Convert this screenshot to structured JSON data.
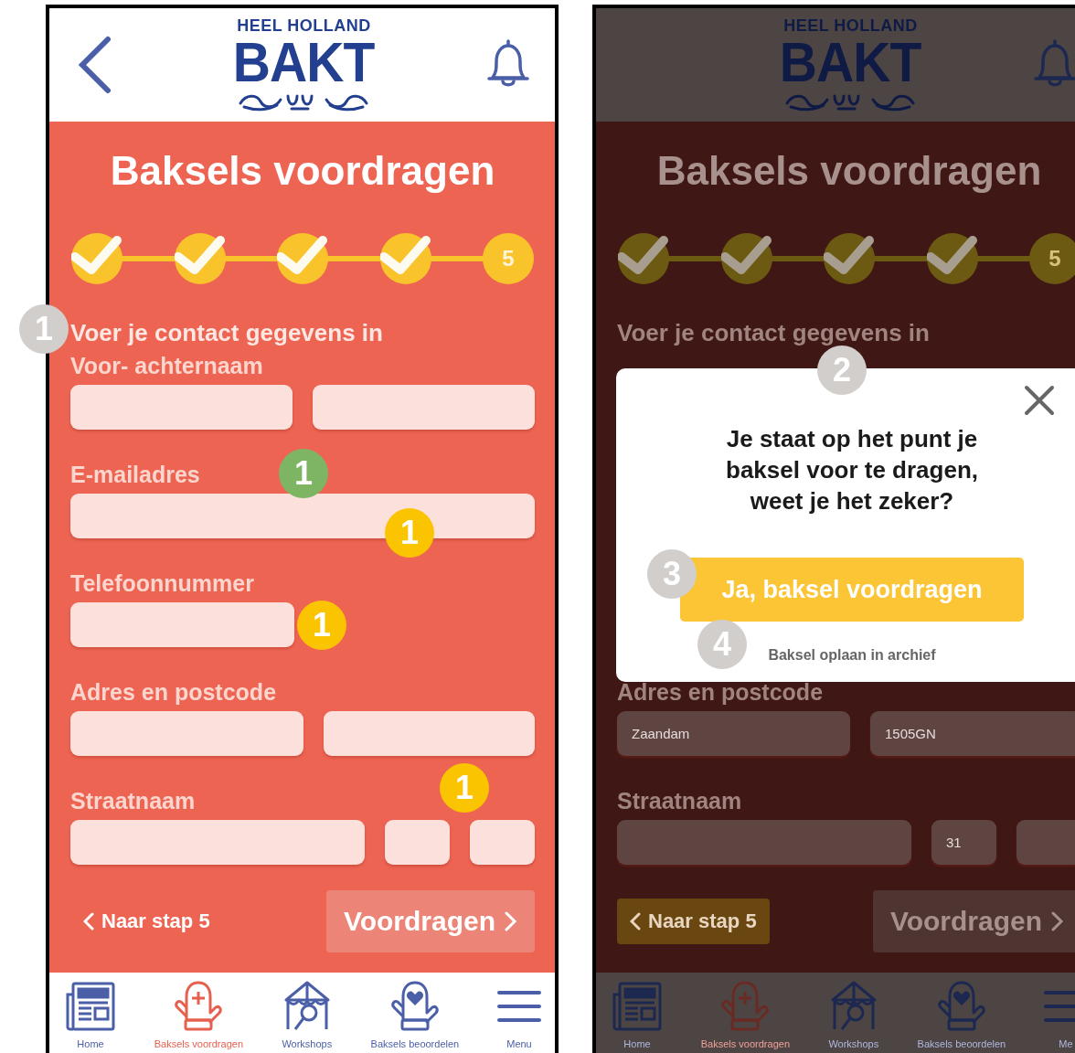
{
  "screens": [
    {
      "back_button": true,
      "logo": {
        "top": "HEEL HOLLAND",
        "main": "BAKT"
      },
      "title": "Baksels voordragen",
      "steps": [
        {
          "done": true
        },
        {
          "done": true
        },
        {
          "done": true
        },
        {
          "done": true
        },
        {
          "done": false,
          "label": "5"
        }
      ],
      "section_title": "Voer je contact gegevens in",
      "groups": [
        {
          "label": "Voor- achternaam",
          "fields": [
            {
              "kind": "half"
            },
            {
              "kind": "half"
            }
          ]
        },
        {
          "label": "E-mailadres",
          "fields": [
            {
              "kind": "full"
            }
          ]
        },
        {
          "label": "Telefoonnummer",
          "fields": [
            {
              "kind": "half"
            }
          ]
        },
        {
          "label": "Adres en postcode",
          "fields": [
            {
              "kind": "wide"
            },
            {
              "kind": "rest"
            }
          ]
        },
        {
          "label": "Straatnaam",
          "fields": [
            {
              "kind": "wide"
            },
            {
              "kind": "small"
            },
            {
              "kind": "small"
            }
          ]
        }
      ],
      "back_link": {
        "label": "Naar stap 5",
        "highlighted": false
      },
      "submit": "Voordragen",
      "nav": [
        {
          "label": "Home",
          "kind": "news",
          "selected": false
        },
        {
          "label": "Baksels voordragen",
          "kind": "mitt-plus",
          "selected": true
        },
        {
          "label": "Workshops",
          "kind": "tent",
          "selected": false
        },
        {
          "label": "Baksels beoordelen",
          "kind": "mitt-heart",
          "selected": false
        },
        {
          "label": "Menu",
          "kind": "menu",
          "selected": false
        }
      ],
      "dimmed": false
    },
    {
      "back_button": false,
      "logo": {
        "top": "HEEL HOLLAND",
        "main": "BAKT"
      },
      "title": "Baksels voordragen",
      "steps": [
        {
          "done": true
        },
        {
          "done": true
        },
        {
          "done": true
        },
        {
          "done": true
        },
        {
          "done": false,
          "label": "5"
        }
      ],
      "section_title": "Voer je contact gegevens in",
      "dialog": {
        "message": "Je staat op het punt je baksel voor te dragen, weet je het zeker?",
        "confirm": "Ja, baksel voordragen",
        "secondary": "Baksel oplaan in archief"
      },
      "groups": [
        {
          "label": "Adres en postcode",
          "fields": [
            {
              "kind": "wide",
              "value": "Zaandam"
            },
            {
              "kind": "rest",
              "value": "1505GN"
            }
          ]
        },
        {
          "label": "Straatnaam",
          "fields": [
            {
              "kind": "wide"
            },
            {
              "kind": "small",
              "value": "31"
            },
            {
              "kind": "small"
            }
          ]
        }
      ],
      "back_link": {
        "label": "Naar stap 5",
        "highlighted": true
      },
      "submit": "Voordragen",
      "nav": [
        {
          "label": "Home",
          "kind": "news",
          "selected": false
        },
        {
          "label": "Baksels voordragen",
          "kind": "mitt-plus",
          "selected": true
        },
        {
          "label": "Workshops",
          "kind": "tent",
          "selected": false
        },
        {
          "label": "Baksels beoordelen",
          "kind": "mitt-heart",
          "selected": false
        },
        {
          "label": "Me",
          "kind": "menu",
          "selected": false
        }
      ],
      "dimmed": true
    }
  ],
  "annotations": [
    {
      "label": "1",
      "color": "#d1cecc"
    },
    {
      "label": "1",
      "color": "#7db562"
    },
    {
      "label": "1",
      "color": "#fbc400"
    },
    {
      "label": "1",
      "color": "#fbc400"
    },
    {
      "label": "1",
      "color": "#fbc400"
    },
    {
      "label": "2",
      "color": "#d1cecc"
    },
    {
      "label": "3",
      "color": "#d1cecc"
    },
    {
      "label": "4",
      "color": "#d1cecc"
    }
  ]
}
